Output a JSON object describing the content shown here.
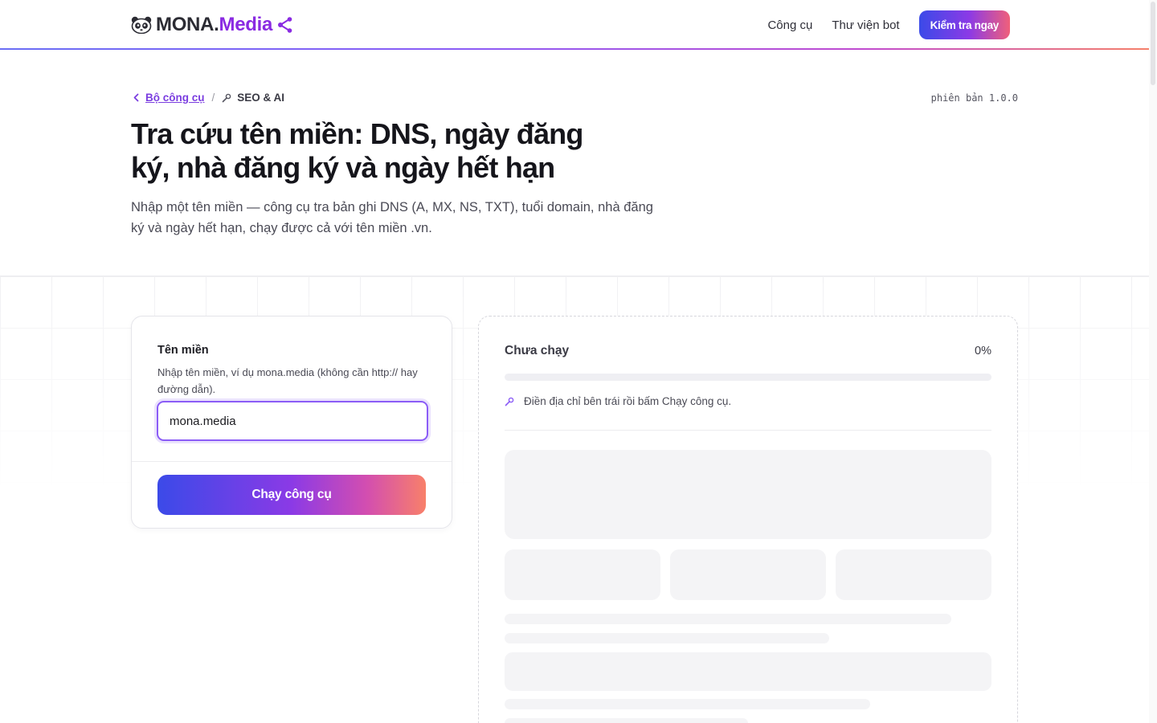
{
  "header": {
    "brand_main": "MONA.",
    "brand_accent": "Media",
    "nav": [
      "Công cụ",
      "Thư viện bot"
    ],
    "cta_label": "Kiểm tra ngay",
    "accent_color": "#8a2be2"
  },
  "breadcrumb": {
    "back_label": "Bộ công cụ",
    "separator": "/",
    "current_label": "SEO & AI",
    "back_icon": "chevron-left-icon",
    "current_icon": "wrench-icon"
  },
  "version": "phiên bản 1.0.0",
  "hero": {
    "title": "Tra cứu tên miền: DNS, ngày đăng ký, nhà đăng ký và ngày hết hạn",
    "subtitle": "Nhập một tên miền — công cụ tra bản ghi DNS (A, MX, NS, TXT), tuổi domain, nhà đăng ký và ngày hết hạn, chạy được cả với tên miền .vn."
  },
  "form": {
    "field_label": "Tên miền",
    "field_help": "Nhập tên miền, ví dụ mona.media (không cần http:// hay đường dẫn).",
    "field_value": "mona.media",
    "run_label": "Chạy công cụ"
  },
  "result": {
    "status": "Chưa chạy",
    "progress_percent": 0,
    "progress_text": "0%",
    "hint": "Điền địa chỉ bên trái rồi bấm Chạy công cụ.",
    "hint_icon": "wrench-icon"
  }
}
